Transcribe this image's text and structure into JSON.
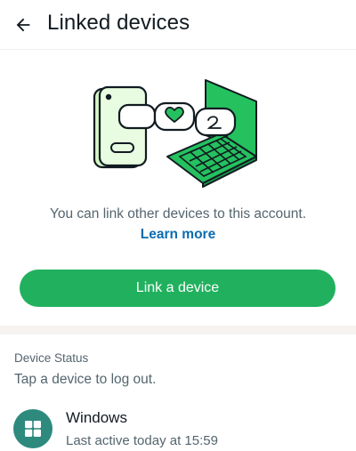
{
  "header": {
    "back_icon": "arrow-left-icon",
    "title": "Linked devices"
  },
  "intro": {
    "illustration_icon": "linked-devices-illustration",
    "text": "You can link other devices to this account.",
    "learn_more": "Learn more"
  },
  "actions": {
    "link_device_label": "Link a device"
  },
  "device_section": {
    "heading": "Device Status",
    "subtext": "Tap a device to log out.",
    "devices": [
      {
        "name": "Windows",
        "status": "Last active today at 15:59",
        "icon": "windows-icon"
      }
    ]
  },
  "colors": {
    "accent": "#21b15e",
    "link": "#0b6cb0",
    "device_avatar": "#2d8a7d"
  }
}
